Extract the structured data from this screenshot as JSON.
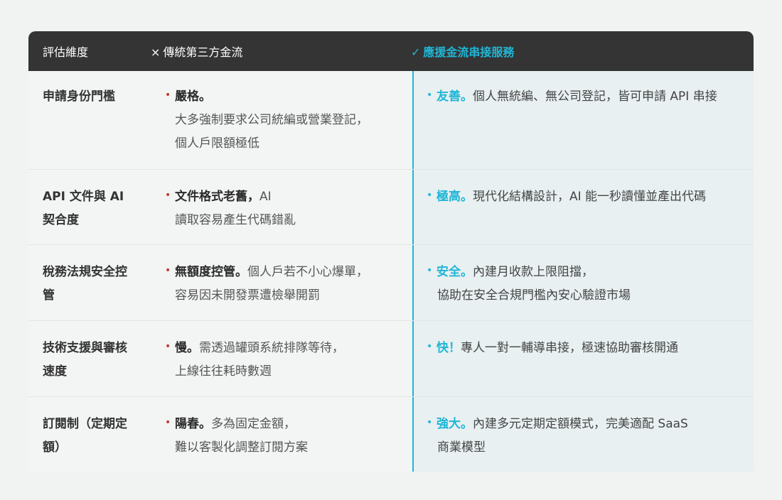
{
  "header": {
    "col1": "評估維度",
    "col2_mark": "×",
    "col2": "傳統第三方金流",
    "col3_mark": "✓",
    "col3": "應援金流串接服務"
  },
  "rows": [
    {
      "dimension": [
        "申請身份門檻"
      ],
      "traditional": {
        "lead": "嚴格。",
        "text": "",
        "lines": [
          "大多強制要求公司統編或營業登記，",
          "個人戶限額極低"
        ]
      },
      "ours": {
        "lead": "友善。",
        "text": "個人無統編、無公司登記，皆可申請 API 串接",
        "lines": []
      }
    },
    {
      "dimension": [
        "API 文件與 AI",
        "契合度"
      ],
      "traditional": {
        "lead": "文件格式老舊，",
        "text": "AI",
        "lines": [
          "讀取容易產生代碼錯亂"
        ]
      },
      "ours": {
        "lead": "極高。",
        "text": "現代化結構設計，AI 能一秒讀懂並產出代碼",
        "lines": []
      }
    },
    {
      "dimension": [
        "稅務法規安全控",
        "管"
      ],
      "traditional": {
        "lead": "無額度控管。",
        "text": "個人戶若不小心爆單，",
        "lines": [
          "容易因未開發票遭檢舉開罰"
        ]
      },
      "ours": {
        "lead": "安全。",
        "text": "內建月收款上限阻擋，",
        "lines": [
          "協助在安全合規門檻內安心驗證市場"
        ]
      }
    },
    {
      "dimension": [
        "技術支援與審核",
        "速度"
      ],
      "traditional": {
        "lead": "慢。",
        "text": "需透過罐頭系統排隊等待，",
        "lines": [
          "上線往往耗時數週"
        ]
      },
      "ours": {
        "lead": "快！",
        "text": "專人一對一輔導串接，極速協助審核開通",
        "lines": []
      }
    },
    {
      "dimension": [
        "訂閱制（定期定",
        "額）"
      ],
      "traditional": {
        "lead": "陽春。",
        "text": "多為固定金額，",
        "lines": [
          "難以客製化調整訂閱方案"
        ]
      },
      "ours": {
        "lead": "強大。",
        "text": "內建多元定期定額模式，完美適配 SaaS",
        "lines": [
          "商業模型"
        ]
      }
    }
  ],
  "colors": {
    "header_bg": "#343434",
    "accent": "#1fb6d6",
    "bullet_traditional": "#c0392b"
  }
}
